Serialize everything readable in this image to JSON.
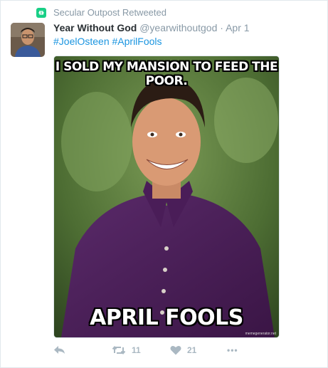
{
  "retweet_context": {
    "text": "Secular Outpost Retweeted",
    "icon": "retweet-icon",
    "badge_color": "#19cf86"
  },
  "tweet": {
    "display_name": "Year Without God",
    "handle": "@yearwithoutgod",
    "separator": "·",
    "timestamp": "Apr 1",
    "hashtags": [
      "#JoelOsteen",
      "#AprilFools"
    ]
  },
  "media": {
    "top_caption": "I SOLD MY MANSION TO FEED THE POOR.",
    "bottom_caption": "APRIL FOOLS",
    "watermark": "memegenerator.net"
  },
  "actions": {
    "reply": {
      "icon": "reply-icon"
    },
    "retweet": {
      "icon": "retweet-icon",
      "count": "11"
    },
    "like": {
      "icon": "heart-icon",
      "count": "21"
    },
    "more": {
      "icon": "more-icon",
      "label": "•••"
    }
  },
  "colors": {
    "link": "#1b95e0",
    "muted": "#8899a6",
    "action": "#aab8c2"
  }
}
